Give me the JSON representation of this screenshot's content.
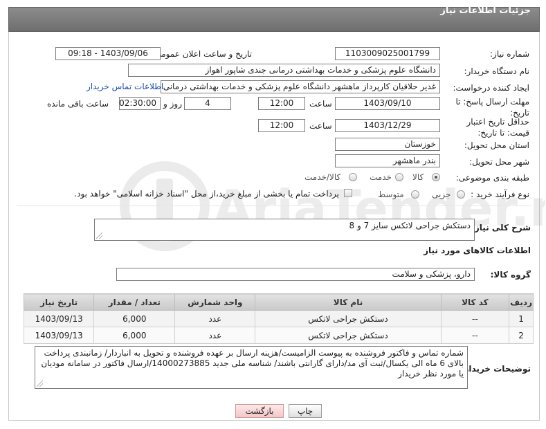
{
  "header": {
    "title": "جزئیات اطلاعات نیاز"
  },
  "need_number": {
    "label": "شماره نیاز:",
    "value": "1103009025001799"
  },
  "announce_datetime": {
    "label": "تاریخ و ساعت اعلان عمومی:",
    "value": "1403/09/06 - 09:18"
  },
  "buyer_org": {
    "label": "نام دستگاه خریدار:",
    "value": "دانشگاه علوم پزشکی و خدمات بهداشتی درمانی جندی شاپور اهواز"
  },
  "requester": {
    "label": "ایجاد کننده درخواست:",
    "value": "غدیر حلاقیان کارپرداز ماهشهر دانشگاه علوم پزشکی و خدمات بهداشتی درمانی",
    "contact_link": "اطلاعات تماس خریدار"
  },
  "reply_deadline": {
    "label": "مهلت ارسال پاسخ: تا تاریخ:",
    "date": "1403/09/10",
    "time_label": "ساعت",
    "time": "12:00",
    "days": "4",
    "days_label": "روز و",
    "remaining": "02:30:00",
    "remaining_label": "ساعت باقی مانده"
  },
  "price_validity": {
    "label": "حداقل تاریخ اعتبار قیمت: تا تاریخ:",
    "date": "1403/12/29",
    "time_label": "ساعت",
    "time": "12:00"
  },
  "delivery_province": {
    "label": "استان محل تحویل:",
    "value": "خوزستان"
  },
  "delivery_city": {
    "label": "شهر محل تحویل:",
    "value": "بندر ماهشهر"
  },
  "category": {
    "label": "طبقه بندی موضوعی:",
    "options": [
      "کالا",
      "خدمت",
      "کالا/خدمت"
    ],
    "selected": "کالا"
  },
  "purchase_type": {
    "label": "نوع فرآیند خرید :",
    "options": [
      "جزیی",
      "متوسط"
    ],
    "checkbox_text": "پرداخت تمام یا بخشی از مبلغ خرید،از محل \"اسناد خزانه اسلامی\" خواهد بود."
  },
  "general_desc": {
    "label": "شرح کلی نیاز:",
    "value": "دستکش جراحی لاتکس سایز 7 و 8"
  },
  "goods_section": {
    "title": "اطلاعات کالاهای مورد نیاز"
  },
  "goods_group": {
    "label": "گروه کالا:",
    "value": "دارو، پزشکی و سلامت"
  },
  "table": {
    "headers": [
      "ردیف",
      "کد کالا",
      "نام کالا",
      "واحد شمارش",
      "تعداد / مقدار",
      "تاریخ نیاز"
    ],
    "rows": [
      [
        "1",
        "--",
        "دستکش جراحی لاتکس",
        "عدد",
        "6,000",
        "1403/09/13"
      ],
      [
        "2",
        "--",
        "دستکش جراحی لاتکس",
        "عدد",
        "6,000",
        "1403/09/13"
      ]
    ]
  },
  "buyer_notes": {
    "label": "توضیحات خریدار:",
    "value": "شماره تماس و فاکتور فروشنده به پیوست الزامیست/هزینه ارسال بر عهده فروشنده و تحویل به انباردار/ زمانبندی پرداخت بالای 6 ماه الی یکسال/ثبت آی مد/دارای گارانتی باشند/ شناسه ملی جدید 14000273885/ارسال فاکتور در سامانه مودیان یا مورد نظر خریدار"
  },
  "buttons": {
    "print": "چاپ",
    "back": "بازگشت"
  },
  "watermark": {
    "text": "AriaTender.net"
  }
}
